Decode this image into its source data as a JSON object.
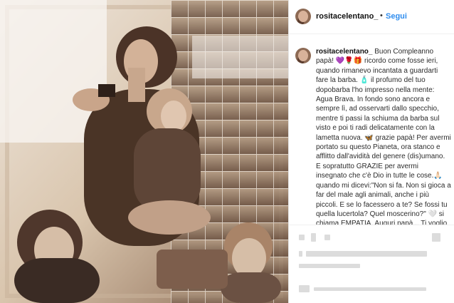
{
  "post": {
    "username": "rositacelentano_",
    "separator": "•",
    "follow_label": "Segui",
    "caption_parts": [
      "Buon Compleanno papà! ",
      "💜🌹🎁",
      " ricordo come fosse ieri, quando rimanevo incantata a guardarti fare la barba. ",
      "🧴",
      " il profumo del tuo dopobarba l'ho impresso nella mente: Agua Brava. In fondo sono ancora e sempre lì, ad osservarti dallo specchio, mentre ti passi la schiuma da barba sul visto e poi ti radi delicatamente con la lametta nuova. ",
      "🦋",
      " grazie papà! Per avermi portato su questo Pianeta, ora stanco e afflitto dall'avidità del genere (dis)umano. E sopratutto GRAZIE per avermi insegnato che c'è Dio in tutte le cose.",
      "🙏🏻",
      " quando mi dicevi:\"Non si fa. Non si gioca a far del male agli animali, anche i più piccoli. E se lo facessero a te? Se fossi tu quella lucertola? Quel moscerino?\" ",
      "🤍",
      " si chiama EMPATIA. Auguri papà... Ti voglio bene sempre ",
      "❤️"
    ]
  },
  "colors": {
    "follow_blue": "#2f8dee",
    "text": "#262626",
    "sepia_light": "#d9c5ad",
    "sepia_dark": "#4a3426"
  }
}
